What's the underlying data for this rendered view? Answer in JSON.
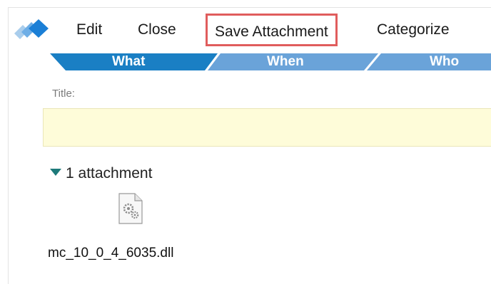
{
  "toolbar": {
    "edit_label": "Edit",
    "close_label": "Close",
    "save_attachment_label": "Save Attachment",
    "categorize_label": "Categorize"
  },
  "tabs": [
    {
      "label": "What",
      "color": "#1a7fc4"
    },
    {
      "label": "When",
      "color": "#6aa3d9"
    },
    {
      "label": "Who",
      "color": "#6aa3d9"
    }
  ],
  "form": {
    "title_label": "Title:",
    "title_value": ""
  },
  "attachments": {
    "header": "1 attachment",
    "files": [
      {
        "name": "mc_10_0_4_6035.dll",
        "icon": "dll-file-icon"
      }
    ]
  },
  "colors": {
    "highlight_border": "#e05d5d",
    "title_field_bg": "#fefcd9",
    "caret": "#1e7a7a"
  }
}
